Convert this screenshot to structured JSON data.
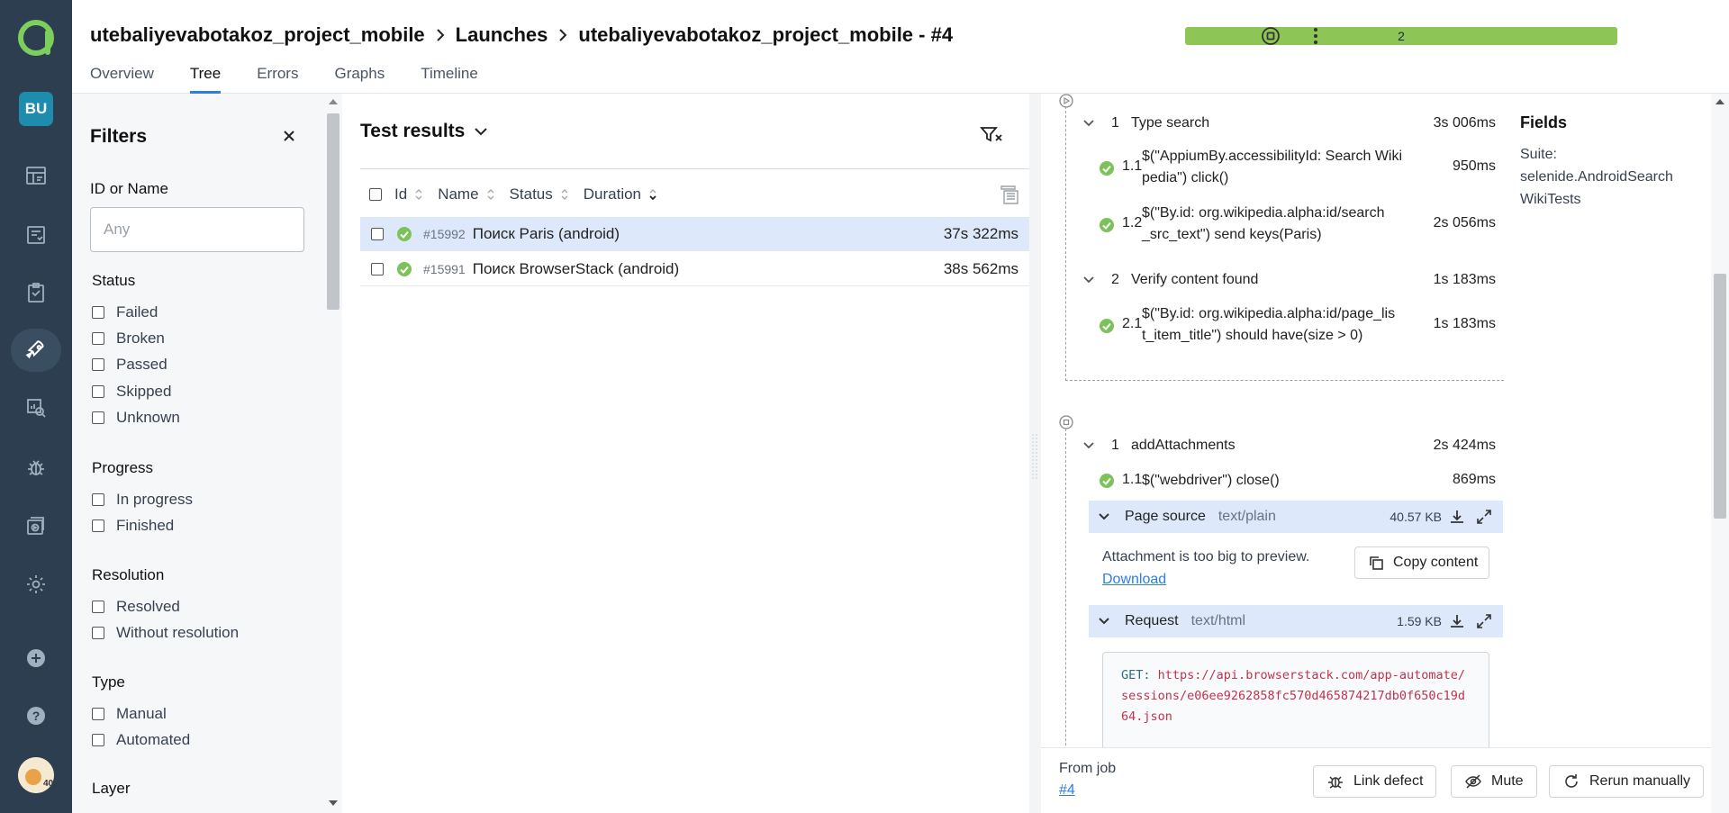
{
  "breadcrumb": {
    "project": "utebaliyevabotakoz_project_mobile",
    "launches": "Launches",
    "launch": "utebaliyevabotakoz_project_mobile - #4"
  },
  "tabs": [
    "Overview",
    "Tree",
    "Errors",
    "Graphs",
    "Timeline"
  ],
  "progress": {
    "label": "2",
    "fraction": 1.0,
    "color": "#8dc656"
  },
  "rail": {
    "project_badge": "BU",
    "accent": "#2c3e50"
  },
  "filters": {
    "title": "Filters",
    "id_label": "ID or Name",
    "id_placeholder": "Any",
    "status_title": "Status",
    "status": [
      "Failed",
      "Broken",
      "Passed",
      "Skipped",
      "Unknown"
    ],
    "progress_title": "Progress",
    "progress": [
      "In progress",
      "Finished"
    ],
    "resolution_title": "Resolution",
    "resolution": [
      "Resolved",
      "Without resolution"
    ],
    "type_title": "Type",
    "type": [
      "Manual",
      "Automated"
    ],
    "layer_title": "Layer"
  },
  "results": {
    "title": "Test results",
    "columns": {
      "id": "Id",
      "name": "Name",
      "status": "Status",
      "duration": "Duration"
    },
    "rows": [
      {
        "id": "#15992",
        "name": "Поиск Paris (android)",
        "duration": "37s 322ms",
        "selected": true
      },
      {
        "id": "#15991",
        "name": "Поиск BrowserStack (android)",
        "duration": "38s 562ms",
        "selected": false
      }
    ]
  },
  "detail": {
    "steps": [
      {
        "num": "1",
        "name": "Type search",
        "time": "3s 006ms"
      },
      {
        "num": "1.1",
        "name": "$(\"AppiumBy.accessibilityId: Search Wikipedia\") click()",
        "line1": "$(\"AppiumBy.accessibilityId: Search Wiki",
        "line2": "pedia\") click()",
        "time": "950ms"
      },
      {
        "num": "1.2",
        "name": "$(\"By.id: org.wikipedia.alpha:id/search_src_text\") send keys(Paris)",
        "line1": "$(\"By.id: org.wikipedia.alpha:id/search",
        "line2": "_src_text\") send keys(Paris)",
        "time": "2s 056ms"
      },
      {
        "num": "2",
        "name": "Verify content found",
        "time": "1s 183ms"
      },
      {
        "num": "2.1",
        "name": "$(\"By.id: org.wikipedia.alpha:id/page_list_item_title\") should have(size > 0)",
        "line1": "$(\"By.id: org.wikipedia.alpha:id/page_lis",
        "line2": "t_item_title\") should have(size > 0)",
        "time": "1s 183ms"
      }
    ],
    "teardown": {
      "num": "1",
      "name": "addAttachments",
      "time": "2s 424ms",
      "sub": {
        "num": "1.1",
        "name": "$(\"webdriver\") close()",
        "time": "869ms"
      },
      "attachment1": {
        "name": "Page source",
        "type": "text/plain",
        "size": "40.57 KB",
        "message": "Attachment is too big to preview.",
        "download": "Download",
        "copy": "Copy content"
      },
      "attachment2": {
        "name": "Request",
        "type": "text/html",
        "size": "1.59 KB",
        "method": "GET:",
        "url": "https://api.browserstack.com/app-automate/sessions/e06ee9262858fc570d465874217db0f650c19d64.json"
      }
    },
    "fields": {
      "title": "Fields",
      "label": "Suite:",
      "value_line1": "selenide.AndroidSearch",
      "value_line2": "WikiTests"
    }
  },
  "footer": {
    "from_job": "From job",
    "job": "#4",
    "link_defect": "Link defect",
    "mute": "Mute",
    "rerun": "Rerun manually"
  }
}
